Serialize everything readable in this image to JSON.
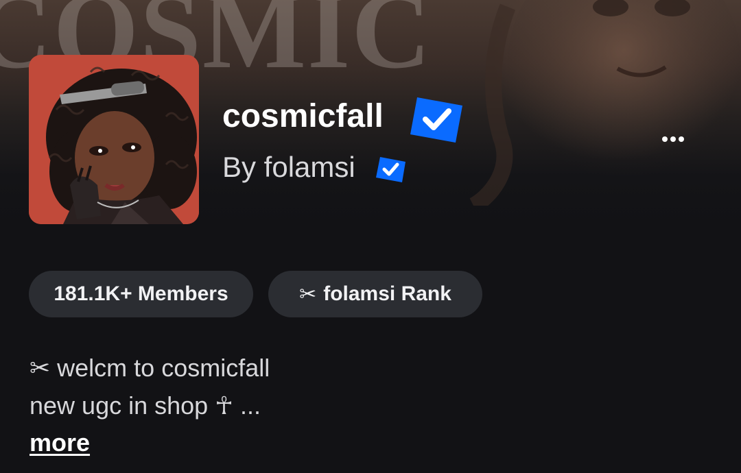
{
  "banner": {
    "word": "COSMIC"
  },
  "group": {
    "name": "cosmicfall",
    "byline": "By folamsi",
    "verified_color": "#0066ff"
  },
  "chips": {
    "members": "181.1K+ Members",
    "rank_icon": "✂",
    "rank": "folamsi Rank"
  },
  "description": {
    "line1": "✂ welcm to cosmicfall",
    "line2": "new ugc in shop ☥ ...",
    "more_label": "more"
  },
  "icons": {
    "more_menu": "more-horizontal-icon",
    "verified": "verified-badge-icon",
    "rank": "scissors-icon"
  }
}
